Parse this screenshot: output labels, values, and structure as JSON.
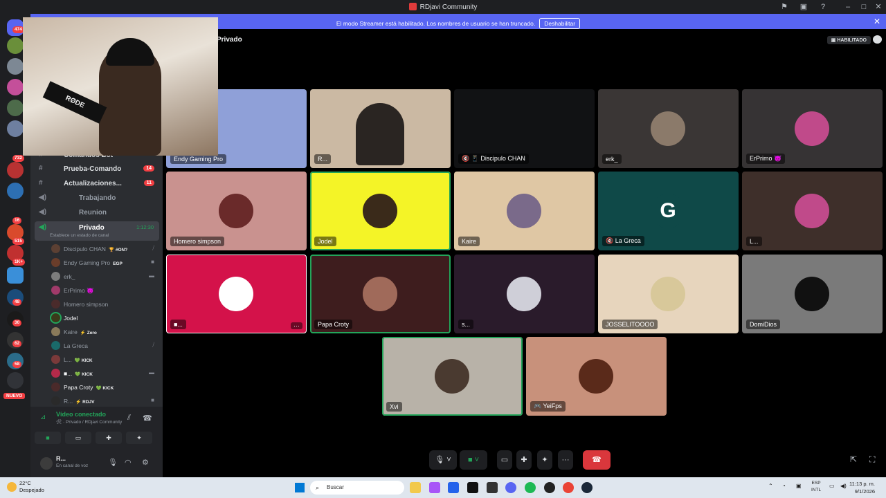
{
  "window": {
    "title": "RDjavi Community"
  },
  "banner": {
    "message": "El modo Streamer está habilitado. Los nombres de usuario se han truncado.",
    "button": "Deshabilitar"
  },
  "servers": {
    "badges": [
      "474",
      "732",
      "16",
      "515",
      "1K+",
      "48",
      "30",
      "62",
      "58"
    ],
    "new_label": "NUEVO"
  },
  "channels": [
    {
      "name": "Comandos Bot",
      "badge": ""
    },
    {
      "name": "Prueba-Comando",
      "badge": "14"
    },
    {
      "name": "Actualizaciones...",
      "badge": "11"
    },
    {
      "name": "Trabajando",
      "badge": ""
    },
    {
      "name": "Reunion",
      "badge": ""
    }
  ],
  "active_channel": {
    "name": "Privado",
    "time": "1:12:30",
    "status": "Establece un estado de canal"
  },
  "voice_users": [
    {
      "name": "Discipulo CHAN",
      "tag": "🏆 #ON?"
    },
    {
      "name": "Endy Gaming Pro",
      "tag": "EGP"
    },
    {
      "name": "erk_",
      "tag": ""
    },
    {
      "name": "ErPrimo 😈",
      "tag": ""
    },
    {
      "name": "Homero simpson",
      "tag": ""
    },
    {
      "name": "Jodel",
      "tag": ""
    },
    {
      "name": "Kaire",
      "tag": "⚡ Zero"
    },
    {
      "name": "La Greca",
      "tag": ""
    },
    {
      "name": "L...",
      "tag": "💚 KICK"
    },
    {
      "name": "■...",
      "tag": "💚 KICK"
    },
    {
      "name": "Papa Croty",
      "tag": "💚 KICK"
    },
    {
      "name": "R...",
      "tag": "⚡ RDJV"
    }
  ],
  "voice_panel": {
    "status": "Vídeo conectado",
    "location": "🛠 · Privado / RDjavi Community"
  },
  "user_panel": {
    "name": "R...",
    "status": "En canal de voz"
  },
  "stage": {
    "header": "Privado",
    "badge": "HABILITADO"
  },
  "webcam": {
    "mic_label": "RØDE"
  },
  "tiles": [
    {
      "label": "Endy Gaming Pro",
      "color": "#8fa0d8"
    },
    {
      "label": "R...",
      "color": "#cbb9a3"
    },
    {
      "label": "🔇 📱 Discipulo CHAN",
      "color": "#111214"
    },
    {
      "label": "erk_",
      "color": "#3a3635"
    },
    {
      "label": "ErPrimo 😈",
      "color": "#363334"
    },
    {
      "label": "Homero simpson",
      "color": "#c9928f"
    },
    {
      "label": "Jodel",
      "color": "#f4f427"
    },
    {
      "label": "Kaire",
      "color": "#dfc7a4"
    },
    {
      "label": "🔇 La Greca",
      "color": "#0f4948"
    },
    {
      "label": "L...",
      "color": "#3e2f2a"
    },
    {
      "label": "■...",
      "color": "#d4124a"
    },
    {
      "label": "Papa Croty",
      "color": "#3e1d1e"
    },
    {
      "label": "s...",
      "color": "#2a1b2b"
    },
    {
      "label": "JOSSELITOOOO",
      "color": "#e7d5bd"
    },
    {
      "label": "DomiDios",
      "color": "#7a7a7a"
    },
    {
      "label": "Xvi",
      "color": "#b8b2a8"
    },
    {
      "label": "🎮 YeiFps",
      "color": "#c8917b"
    }
  ],
  "taskbar": {
    "weather_temp": "22°C",
    "weather_desc": "Despejado",
    "search": "Buscar",
    "lang1": "ESP",
    "lang2": "INTL",
    "time": "11:13 p. m.",
    "date": "9/1/2026"
  }
}
